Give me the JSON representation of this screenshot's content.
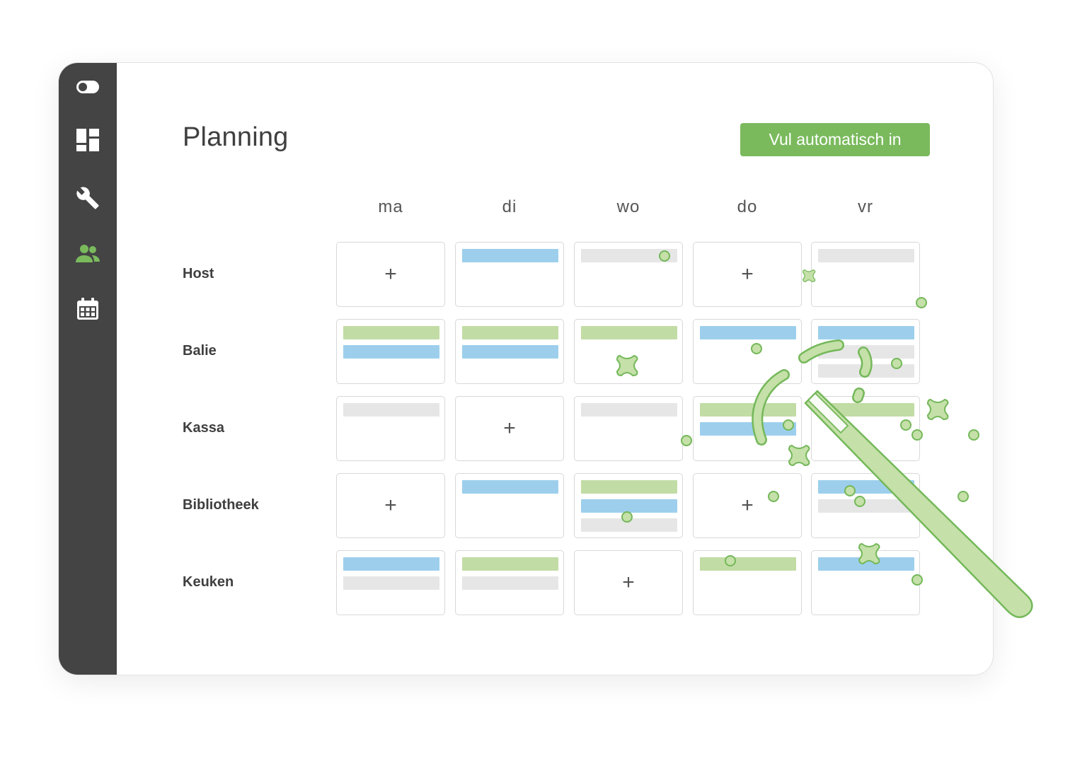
{
  "page": {
    "title": "Planning",
    "autofill_button": "Vul automatisch in"
  },
  "sidebar": {
    "items": [
      {
        "icon": "toggle-icon",
        "active": false
      },
      {
        "icon": "dashboard-icon",
        "active": false
      },
      {
        "icon": "wrench-icon",
        "active": false
      },
      {
        "icon": "users-icon",
        "active": true
      },
      {
        "icon": "calendar-icon",
        "active": false
      }
    ]
  },
  "schedule": {
    "days": [
      "ma",
      "di",
      "wo",
      "do",
      "vr"
    ],
    "rows": [
      {
        "label": "Host",
        "cells": [
          [
            "plus"
          ],
          [
            "blue"
          ],
          [
            "gray"
          ],
          [
            "plus"
          ],
          [
            "gray"
          ]
        ]
      },
      {
        "label": "Balie",
        "cells": [
          [
            "green",
            "blue"
          ],
          [
            "green",
            "blue"
          ],
          [
            "green"
          ],
          [
            "blue"
          ],
          [
            "blue",
            "gray",
            "gray"
          ]
        ]
      },
      {
        "label": "Kassa",
        "cells": [
          [
            "gray"
          ],
          [
            "plus"
          ],
          [
            "gray"
          ],
          [
            "green",
            "blue"
          ],
          [
            "green"
          ]
        ]
      },
      {
        "label": "Bibliotheek",
        "cells": [
          [
            "plus"
          ],
          [
            "blue"
          ],
          [
            "green",
            "blue",
            "gray"
          ],
          [
            "plus"
          ],
          [
            "blue",
            "gray"
          ]
        ]
      },
      {
        "label": "Keuken",
        "cells": [
          [
            "blue",
            "gray"
          ],
          [
            "green",
            "gray"
          ],
          [
            "plus"
          ],
          [
            "green"
          ],
          [
            "blue"
          ]
        ]
      }
    ]
  },
  "colors": {
    "sidebar_bg": "#444444",
    "accent": "#7aba5d",
    "active_icon": "#7aba5d",
    "icon": "#ffffff",
    "bar_green": "#c2dca5",
    "bar_blue": "#9dcfed",
    "bar_gray": "#e6e6e6",
    "wand_fill": "#c5e0a8",
    "wand_stroke": "#74b85a"
  },
  "decoration": {
    "wand_icon": "magic-wand-icon",
    "sparkle_icon": "sparkle-icon"
  }
}
